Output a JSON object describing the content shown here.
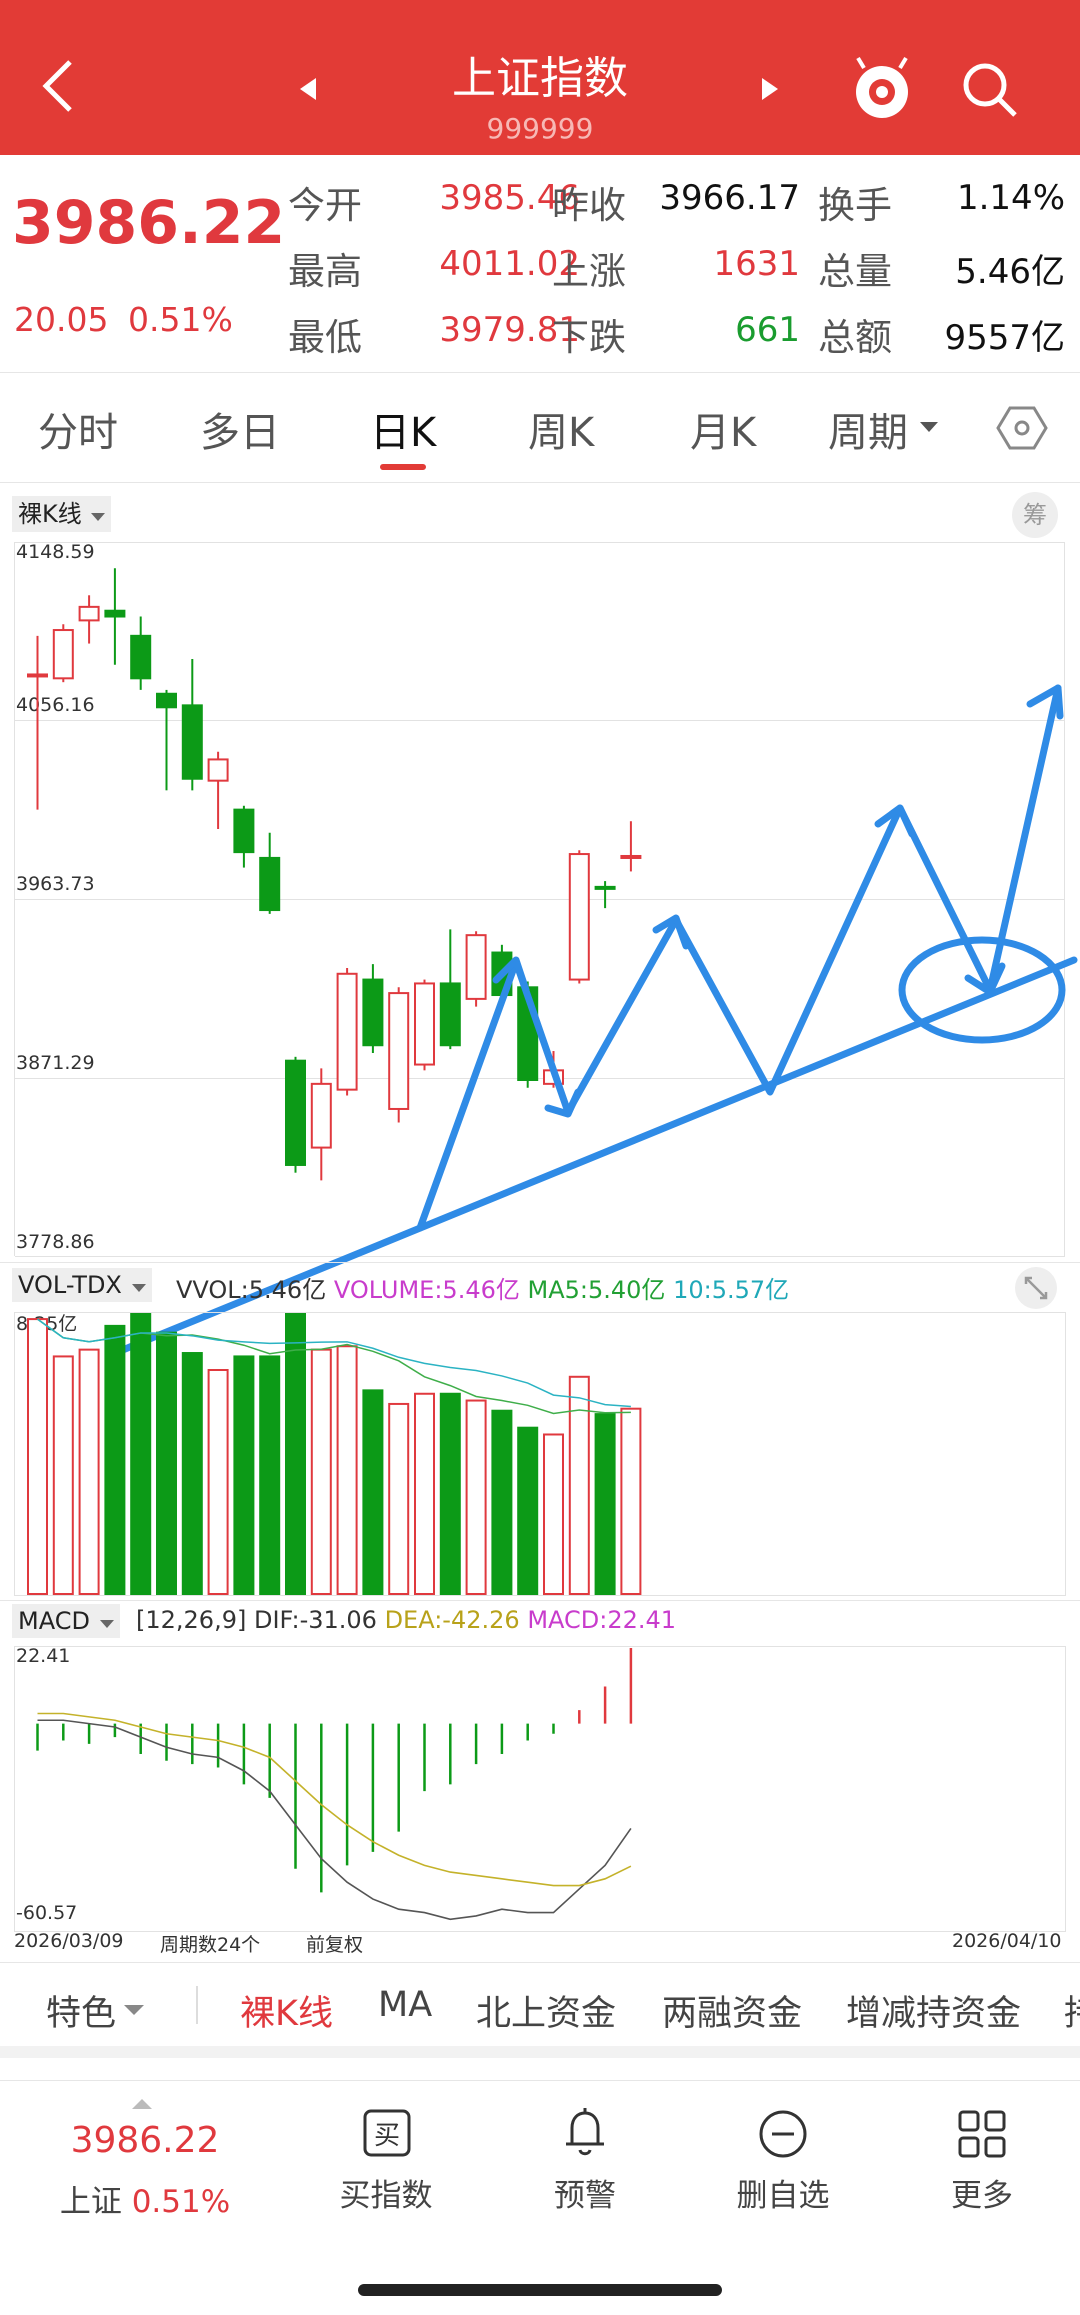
{
  "header": {
    "title": "上证指数",
    "code": "999999"
  },
  "quote": {
    "price": "3986.22",
    "change": "20.05",
    "change_pct": "0.51%",
    "rows": [
      {
        "l1": "今开",
        "v1": "3985.46",
        "l2": "昨收",
        "v2": "3966.17",
        "l3": "换手",
        "v3": "1.14%"
      },
      {
        "l1": "最高",
        "v1": "4011.02",
        "l2": "上涨",
        "v2": "1631",
        "l3": "总量",
        "v3": "5.46亿"
      },
      {
        "l1": "最低",
        "v1": "3979.81",
        "l2": "下跌",
        "v2": "661",
        "l3": "总额",
        "v3": "9557亿"
      }
    ]
  },
  "tabs": [
    "分时",
    "多日",
    "日K",
    "周K",
    "月K",
    "周期"
  ],
  "active_tab": "日K",
  "kline": {
    "type_label": "裸K线",
    "chip_label": "筹",
    "y_ticks": [
      "4148.59",
      "4056.16",
      "3963.73",
      "3871.29",
      "3778.86"
    ]
  },
  "vol": {
    "name": "VOL-TDX",
    "vvol": "VVOL:5.46亿",
    "volume": "VOLUME:5.46亿",
    "ma5": "MA5:5.40亿",
    "ma10": "10:5.57亿",
    "max_label": "8.25亿"
  },
  "macd": {
    "name": "MACD",
    "params": "[12,26,9]",
    "dif": "DIF:-31.06",
    "dea": "DEA:-42.26",
    "macd": "MACD:22.41",
    "top": "22.41",
    "bottom": "-60.57"
  },
  "footer_axis": {
    "start": "2026/03/09",
    "count": "周期数24个",
    "adj": "前复权",
    "end": "2026/04/10"
  },
  "features": [
    "特色",
    "裸K线",
    "MA",
    "北上资金",
    "两融资金",
    "增减持资金",
    "持"
  ],
  "bottom_nav": {
    "price": "3986.22",
    "label": "上证",
    "pct": "0.51%",
    "items": [
      "买指数",
      "预警",
      "删自选",
      "更多"
    ]
  },
  "colors": {
    "up": "#e0393e",
    "down": "#0c9a17",
    "header": "#e23b36",
    "annotation": "#2f8be6"
  },
  "chart_data": {
    "type": "candlestick",
    "ylim": [
      3778.86,
      4148.59
    ],
    "x_range": [
      "2026/03/09",
      "2026/04/10"
    ],
    "candles": [
      {
        "o": 4080,
        "c": 4080,
        "h": 4100,
        "l": 4010
      },
      {
        "o": 4078,
        "c": 4103,
        "h": 4106,
        "l": 4076
      },
      {
        "o": 4108,
        "c": 4115,
        "h": 4121,
        "l": 4096
      },
      {
        "o": 4113,
        "c": 4110,
        "h": 4135,
        "l": 4085
      },
      {
        "o": 4100,
        "c": 4078,
        "h": 4110,
        "l": 4072
      },
      {
        "o": 4070,
        "c": 4063,
        "h": 4072,
        "l": 4020
      },
      {
        "o": 4064,
        "c": 4026,
        "h": 4088,
        "l": 4020
      },
      {
        "o": 4025,
        "c": 4036,
        "h": 4040,
        "l": 4000
      },
      {
        "o": 4010,
        "c": 3988,
        "h": 4012,
        "l": 3980
      },
      {
        "o": 3985,
        "c": 3958,
        "h": 3998,
        "l": 3956
      },
      {
        "o": 3880,
        "c": 3826,
        "h": 3882,
        "l": 3822
      },
      {
        "o": 3835,
        "c": 3868,
        "h": 3876,
        "l": 3818
      },
      {
        "o": 3865,
        "c": 3925,
        "h": 3928,
        "l": 3862
      },
      {
        "o": 3922,
        "c": 3888,
        "h": 3930,
        "l": 3884
      },
      {
        "o": 3855,
        "c": 3915,
        "h": 3918,
        "l": 3848
      },
      {
        "o": 3878,
        "c": 3920,
        "h": 3922,
        "l": 3875
      },
      {
        "o": 3920,
        "c": 3888,
        "h": 3948,
        "l": 3886
      },
      {
        "o": 3912,
        "c": 3945,
        "h": 3947,
        "l": 3908
      },
      {
        "o": 3936,
        "c": 3914,
        "h": 3940,
        "l": 3908
      },
      {
        "o": 3918,
        "c": 3870,
        "h": 3921,
        "l": 3866
      },
      {
        "o": 3868,
        "c": 3875,
        "h": 3885,
        "l": 3866
      },
      {
        "o": 3922,
        "c": 3987,
        "h": 3989,
        "l": 3920
      },
      {
        "o": 3970,
        "c": 3969,
        "h": 3973,
        "l": 3959
      },
      {
        "o": 3985,
        "c": 3986,
        "h": 4004,
        "l": 3978
      }
    ],
    "volume_ylim": [
      0,
      8.25
    ],
    "volume": [
      8.1,
      7.0,
      7.2,
      7.9,
      8.25,
      7.7,
      7.1,
      6.6,
      7.0,
      7.0,
      8.25,
      7.2,
      7.3,
      6.0,
      5.6,
      5.9,
      5.9,
      5.7,
      5.4,
      4.9,
      4.7,
      6.4,
      5.3,
      5.46
    ],
    "macd_ylim": [
      -60.57,
      22.41
    ],
    "macd_hist": [
      -8,
      -5,
      -6,
      -4,
      -9,
      -11,
      -12,
      -13,
      -18,
      -22,
      -43,
      -50,
      -42,
      -38,
      -32,
      -20,
      -18,
      -12,
      -9,
      -5,
      -3,
      4,
      11,
      22.41
    ],
    "dif": [
      1,
      1,
      0,
      -1,
      -4,
      -7,
      -9,
      -10,
      -14,
      -20,
      -30,
      -40,
      -47,
      -52,
      -55,
      -56,
      -58,
      -57,
      -55,
      -56,
      -56,
      -49,
      -42,
      -31.06
    ],
    "dea": [
      3,
      3,
      2,
      1,
      -1,
      -3,
      -4,
      -5,
      -7,
      -10,
      -17,
      -24,
      -30,
      -35,
      -39,
      -42,
      -44,
      -45,
      -46,
      -47,
      -48,
      -48,
      -46,
      -42.26
    ]
  }
}
